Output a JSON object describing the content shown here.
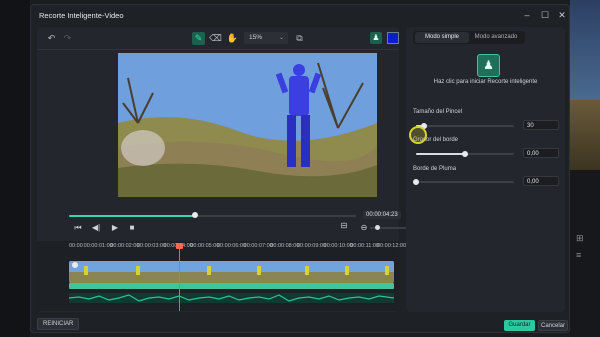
{
  "dialog": {
    "title": "Recorte Inteligente-Video"
  },
  "toolbar": {
    "zoom": "15%"
  },
  "player": {
    "timecode": "00:00:04:23",
    "progress_fraction": 0.44
  },
  "timeline": {
    "ticks": [
      "00:00",
      "00:00:01:00",
      "00:00:02:00",
      "00:00:03:00",
      "00:00:04:00",
      "00:00:05:00",
      "00:00:06:00",
      "00:00:07:00",
      "00:00:08:00",
      "00:00:09:00",
      "00:00:10:00",
      "00:00:11:00",
      "00:00:12:00"
    ]
  },
  "footer": {
    "reset_label": "REINICIAR",
    "save_label": "Guardar",
    "cancel_label": "Cancelar"
  },
  "panel": {
    "tabs": [
      {
        "label": "Modo simple",
        "active": true
      },
      {
        "label": "Modo avanzado",
        "active": false
      }
    ],
    "hint": "Haz clic para iniciar Recorte inteligente",
    "params": [
      {
        "label": "Tamaño del Pincel",
        "value": "30",
        "level": 0.08
      },
      {
        "label": "Grosor del borde",
        "value": "0,00",
        "level": 0.5
      },
      {
        "label": "Borde de Pluma",
        "value": "0,00",
        "level": 0.0
      }
    ]
  },
  "colors": {
    "accent": "#2ec8a0",
    "mask_color": "#0b1fc9",
    "playhead": "#ff5a4e"
  }
}
